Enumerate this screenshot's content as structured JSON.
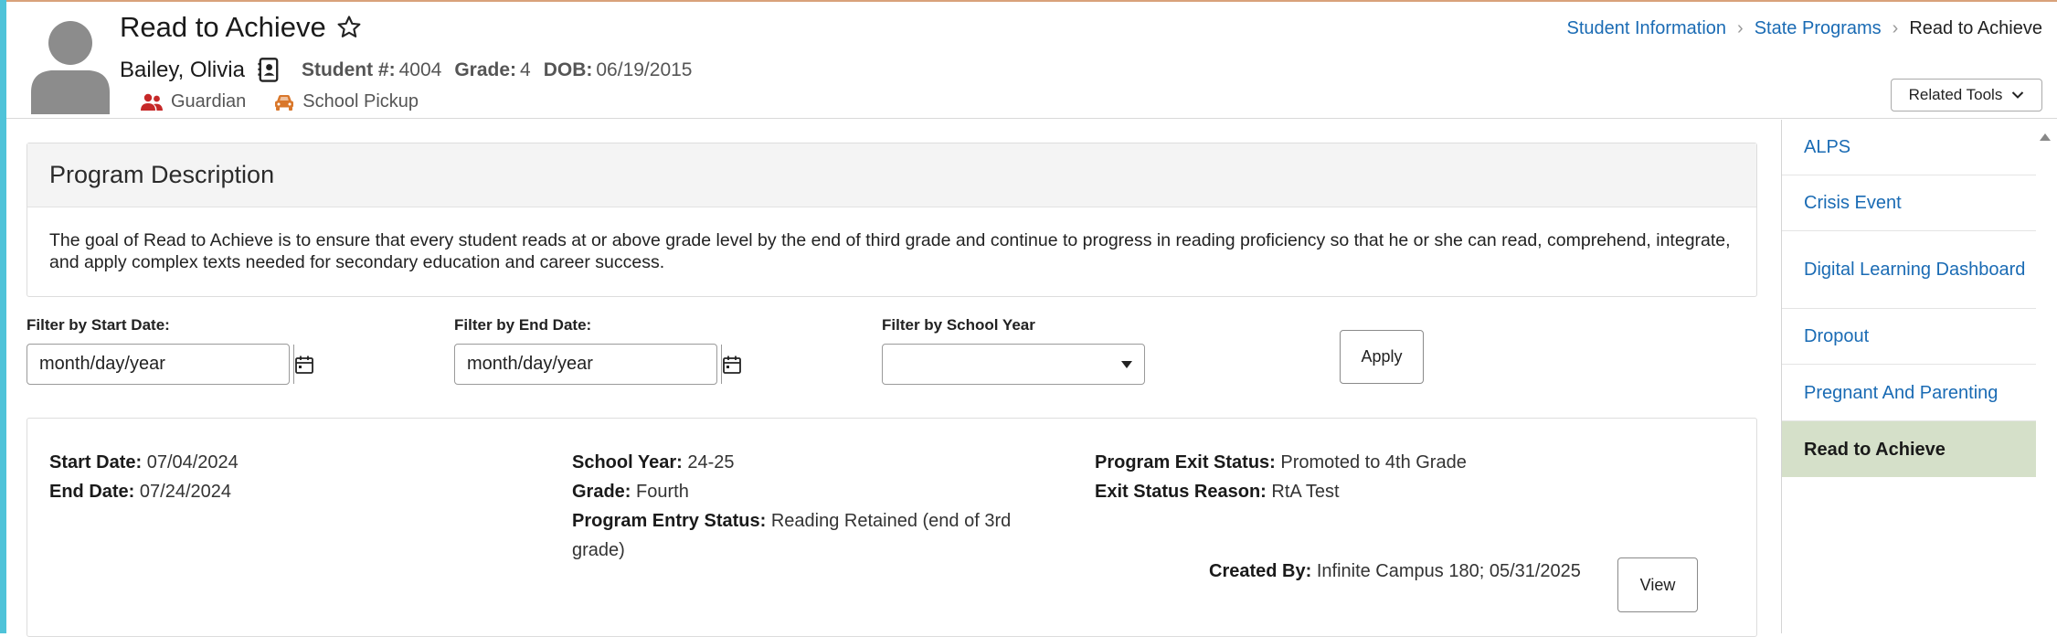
{
  "header": {
    "title": "Read to Achieve",
    "student": {
      "name": "Bailey, Olivia",
      "student_no_label": "Student #:",
      "student_no": "4004",
      "grade_label": "Grade:",
      "grade": "4",
      "dob_label": "DOB:",
      "dob": "06/19/2015"
    },
    "links": {
      "guardian": "Guardian",
      "school_pickup": "School Pickup"
    },
    "breadcrumb": [
      "Student Information",
      "State Programs",
      "Read to Achieve"
    ],
    "related_tools": "Related Tools"
  },
  "program_description": {
    "title": "Program Description",
    "body": "The goal of Read to Achieve is to ensure that every student reads at or above grade level by the end of third grade and continue to progress in reading proficiency so that he or she can read, comprehend, integrate, and apply complex texts needed for secondary education and career success."
  },
  "filters": {
    "start_label": "Filter by Start Date:",
    "start_placeholder": "month/day/year",
    "end_label": "Filter by End Date:",
    "end_placeholder": "month/day/year",
    "year_label": "Filter by School Year",
    "year_value": "",
    "apply": "Apply"
  },
  "record": {
    "start_label": "Start Date:",
    "start": "07/04/2024",
    "end_label": "End Date:",
    "end": "07/24/2024",
    "school_year_label": "School Year:",
    "school_year": "24-25",
    "grade_label": "Grade:",
    "grade": "Fourth",
    "entry_status_label": "Program Entry Status:",
    "entry_status": "Reading Retained (end of 3rd grade)",
    "exit_status_label": "Program Exit Status:",
    "exit_status": "Promoted to 4th Grade",
    "exit_reason_label": "Exit Status Reason:",
    "exit_reason": "RtA Test",
    "created_label": "Created By:",
    "created": "Infinite Campus 180; 05/31/2025",
    "view": "View"
  },
  "sidebar": {
    "items": [
      {
        "label": "ALPS"
      },
      {
        "label": "Crisis Event"
      },
      {
        "label": "Digital Learning Dashboard"
      },
      {
        "label": "Dropout"
      },
      {
        "label": "Pregnant And Parenting"
      },
      {
        "label": "Read to Achieve"
      }
    ],
    "active_index": 5
  },
  "colors": {
    "link": "#1a6bb4",
    "active_bg": "#d5e0c9",
    "accent_left": "#4fc3d9",
    "guardian_icon": "#c62828",
    "pickup_icon": "#d9772b"
  }
}
